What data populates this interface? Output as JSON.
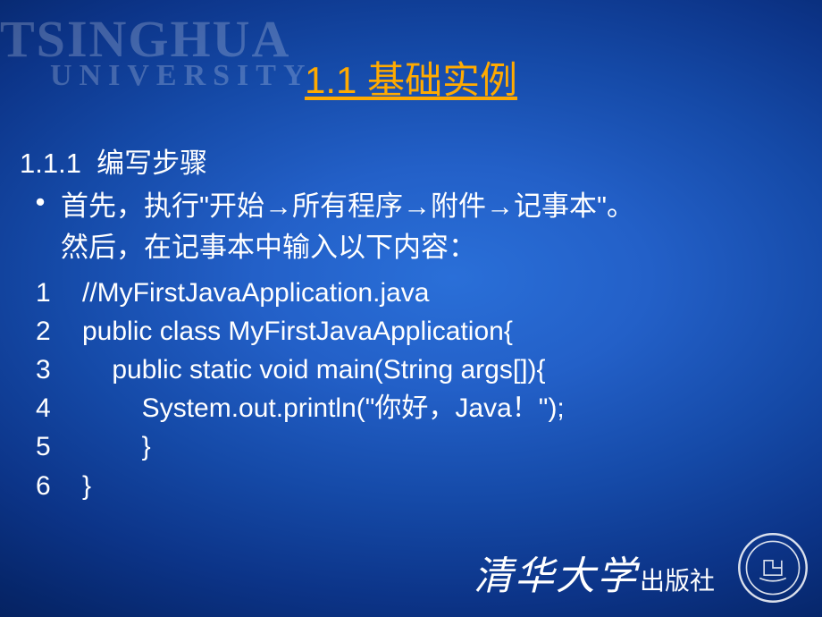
{
  "watermark": {
    "line1": "TSINGHUA",
    "line2": "UNIVERSITY"
  },
  "title": "1.1  基础实例",
  "subheading": "1.1.1  编写步骤",
  "bullet": {
    "symbol": "•",
    "text_line1": "首先，执行\"开始→所有程序→附件→记事本\"。",
    "text_line2": "然后，在记事本中输入以下内容："
  },
  "code": [
    {
      "n": "1",
      "text": "//MyFirstJavaApplication.java"
    },
    {
      "n": "2",
      "text": "public class MyFirstJavaApplication{"
    },
    {
      "n": "3",
      "text": "    public static void main(String args[]){"
    },
    {
      "n": "4",
      "text": "        System.out.println(\"你好，Java！\");"
    },
    {
      "n": "5",
      "text": "        }"
    },
    {
      "n": "6",
      "text": "}"
    }
  ],
  "footer": {
    "big": "清华大学",
    "small": "出版社",
    "seal_aria": "Tsinghua University Seal"
  }
}
